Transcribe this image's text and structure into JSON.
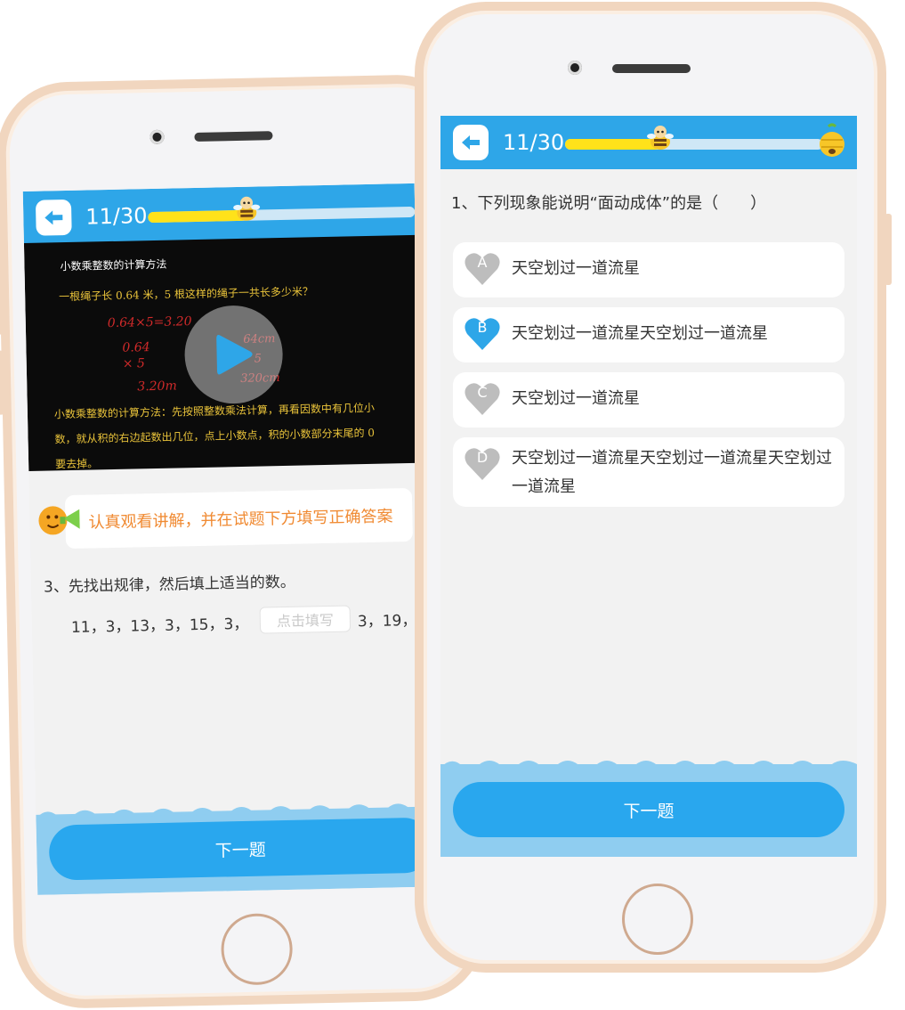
{
  "colors": {
    "accent": "#2ea6e8",
    "progress": "#ffe21a",
    "hint": "#f08a32",
    "selected": "#2ea6e8",
    "unselected": "#bdbdbd"
  },
  "left": {
    "progress": "11/30",
    "progress_fraction": 0.37,
    "video": {
      "title": "小数乘整数的计算方法",
      "problem": "一根绳子长 0.64 米，5 根这样的绳子一共长多少米？",
      "handwriting": [
        "0.64×5=3.20",
        "0.64",
        "×    5",
        "3.20m",
        "64cm",
        "5",
        "320cm"
      ],
      "line1": "小数乘整数的计算方法：先按照整数乘法计算，再看因数中有几位小",
      "line2": "数，就从积的右边起数出几位，点上小数点，积的小数部分末尾的 0",
      "line3": "要去掉。"
    },
    "hint": "认真观看讲解，并在试题下方填写正确答案",
    "question": "3、先找出规律，然后填上适当的数。",
    "sequence_before": "11，3，13，3，15，3，",
    "blank_placeholder": "点击填写",
    "sequence_after": "3，19，",
    "next": "下一题"
  },
  "right": {
    "progress": "11/30",
    "progress_fraction": 0.37,
    "question": "1、下列现象能说明“面动成体”的是（　　）",
    "options": [
      {
        "letter": "A",
        "text": "天空划过一道流星",
        "selected": false
      },
      {
        "letter": "B",
        "text": "天空划过一道流星天空划过一道流星",
        "selected": true
      },
      {
        "letter": "C",
        "text": "天空划过一道流星",
        "selected": false
      },
      {
        "letter": "D",
        "text": "天空划过一道流星天空划过一道流星天空划过一道流星",
        "selected": false
      }
    ],
    "next": "下一题"
  }
}
